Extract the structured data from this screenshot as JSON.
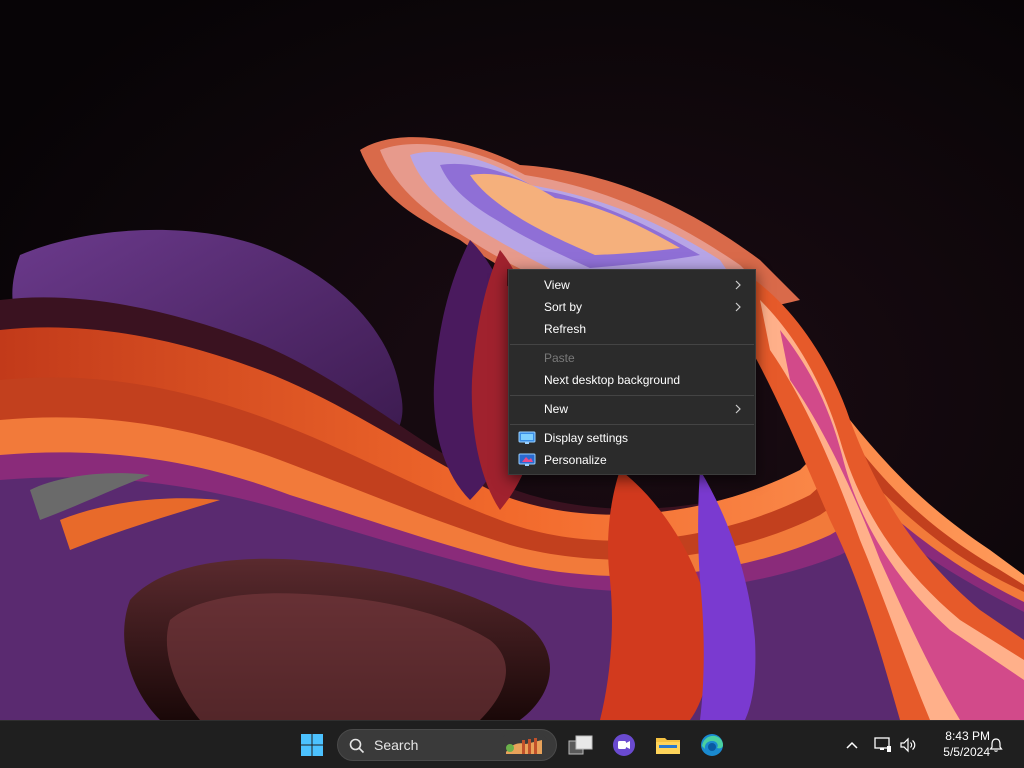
{
  "context_menu": {
    "items": [
      {
        "label": "View",
        "submenu": true
      },
      {
        "label": "Sort by",
        "submenu": true
      },
      {
        "label": "Refresh",
        "submenu": false
      },
      {
        "label": "Paste",
        "submenu": false,
        "disabled": true
      },
      {
        "label": "Next desktop background",
        "submenu": false
      },
      {
        "label": "New",
        "submenu": true
      },
      {
        "label": "Display settings",
        "icon": "display-icon"
      },
      {
        "label": "Personalize",
        "icon": "personalize-icon"
      }
    ]
  },
  "taskbar": {
    "search_placeholder": "Search",
    "apps": [
      {
        "name": "start",
        "icon": "windows-logo-icon"
      },
      {
        "name": "task-view",
        "icon": "task-view-icon"
      },
      {
        "name": "meet",
        "icon": "video-chat-icon"
      },
      {
        "name": "file-explorer",
        "icon": "folder-icon"
      },
      {
        "name": "edge",
        "icon": "edge-browser-icon"
      }
    ],
    "clock": {
      "time": "8:43 PM",
      "date": "5/5/2024"
    }
  },
  "colors": {
    "menu_bg": "#2b2b2b",
    "taskbar_bg": "#1f1f1f",
    "accent_blue": "#4cc2ff"
  }
}
